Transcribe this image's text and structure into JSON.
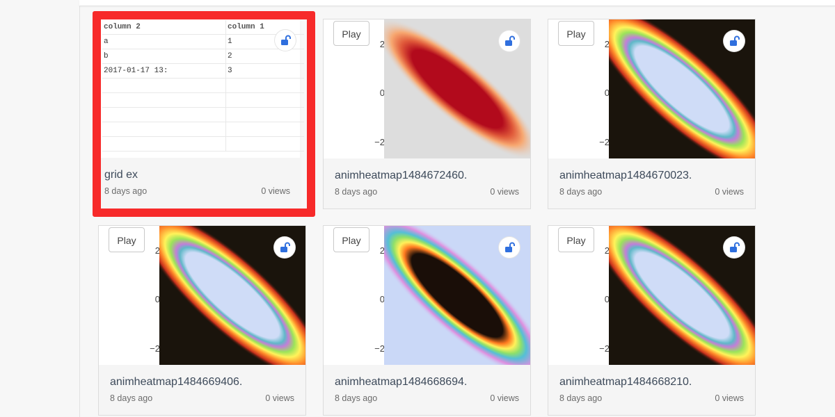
{
  "page": {
    "colors": {
      "selection": "#f72a2a",
      "background": "#f7f7f7",
      "lock_icon": "#2f6fde"
    }
  },
  "cards": [
    {
      "title": "grid ex",
      "age": "8 days ago",
      "views": "0 views",
      "grid": {
        "headers": [
          "column 2",
          "column 1"
        ],
        "rows": [
          [
            "a",
            "1"
          ],
          [
            "b",
            "2"
          ],
          [
            "2017-01-17 13:",
            "3"
          ]
        ]
      }
    },
    {
      "title": "animheatmap1484672460.",
      "age": "8 days ago",
      "views": "0 views",
      "play_label": "Play",
      "yticks": [
        "2",
        "0",
        "−2"
      ],
      "colorscale": "reds"
    },
    {
      "title": "animheatmap1484670023.",
      "age": "8 days ago",
      "views": "0 views",
      "play_label": "Play",
      "yticks": [
        "2",
        "0",
        "−2"
      ],
      "colorscale": "hot-rainbow"
    },
    {
      "title": "animheatmap1484669406.",
      "age": "8 days ago",
      "views": "0 views",
      "play_label": "Play",
      "yticks": [
        "2",
        "0",
        "−2"
      ],
      "colorscale": "hot-rainbow"
    },
    {
      "title": "animheatmap1484668694.",
      "age": "8 days ago",
      "views": "0 views",
      "play_label": "Play",
      "yticks": [
        "2",
        "0",
        "−2"
      ],
      "colorscale": "inverted-rainbow"
    },
    {
      "title": "animheatmap1484668210.",
      "age": "8 days ago",
      "views": "0 views",
      "play_label": "Play",
      "yticks": [
        "2",
        "0",
        "−2"
      ],
      "colorscale": "hot-rainbow"
    }
  ]
}
